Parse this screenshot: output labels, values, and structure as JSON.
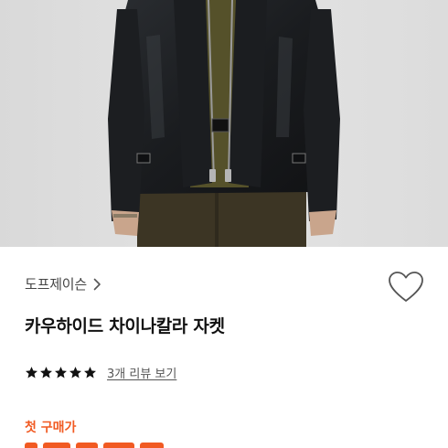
{
  "product": {
    "brand": "도프제이슨",
    "title": "카우하이드 차이나칼라 자켓",
    "rating": 5,
    "rating_max": 5,
    "reviews_label": "3개 리뷰 보기",
    "promo_label": "첫 구매가"
  },
  "icons": {
    "brand_chevron": "chevron-right-icon",
    "wishlist": "heart-outline-icon",
    "rating": "star-icon"
  },
  "colors": {
    "accent": "#f15a22",
    "star": "#111111"
  }
}
